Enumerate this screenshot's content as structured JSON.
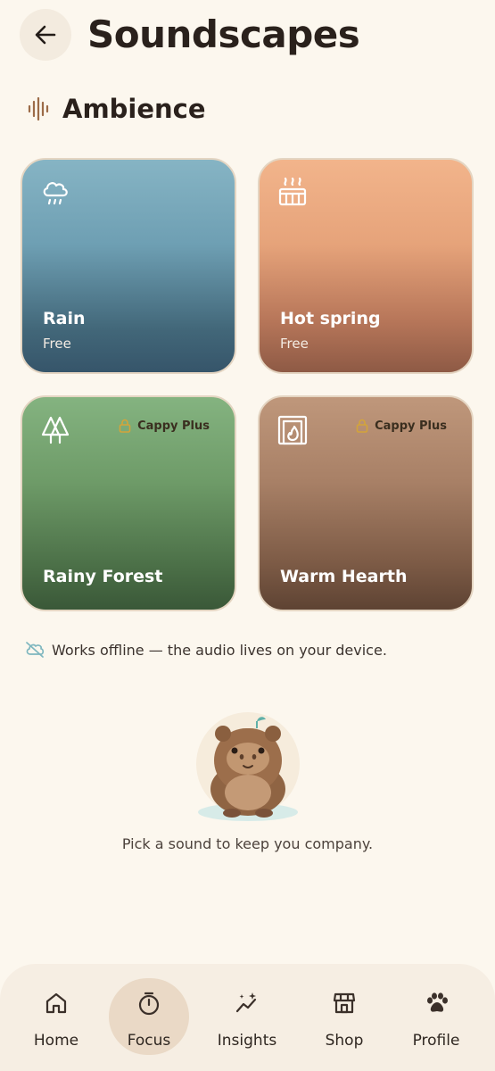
{
  "header": {
    "title": "Soundscapes",
    "back_icon": "arrow-left-icon"
  },
  "section": {
    "title": "Ambience",
    "icon": "sound-wave-icon"
  },
  "cards": [
    {
      "name": "Rain",
      "subtitle": "Free",
      "icon": "rain-cloud-icon"
    },
    {
      "name": "Hot spring",
      "subtitle": "Free",
      "icon": "hot-spring-icon"
    },
    {
      "name": "Rainy Forest",
      "badge": "Cappy Plus",
      "icon": "pine-trees-icon"
    },
    {
      "name": "Warm Hearth",
      "badge": "Cappy Plus",
      "icon": "fireplace-icon"
    }
  ],
  "offline_note": "Works offline — the audio lives on your device.",
  "empty_state": {
    "caption": "Pick a sound to keep you company."
  },
  "nav": {
    "items": [
      {
        "label": "Home",
        "icon": "home-icon"
      },
      {
        "label": "Focus",
        "icon": "stopwatch-icon",
        "active": true
      },
      {
        "label": "Insights",
        "icon": "insights-icon"
      },
      {
        "label": "Shop",
        "icon": "shop-icon"
      },
      {
        "label": "Profile",
        "icon": "paw-icon"
      }
    ]
  },
  "colors": {
    "background": "#fcf7ee",
    "badge_lock": "#d3a43a",
    "offline_icon": "#7fb7bf"
  }
}
